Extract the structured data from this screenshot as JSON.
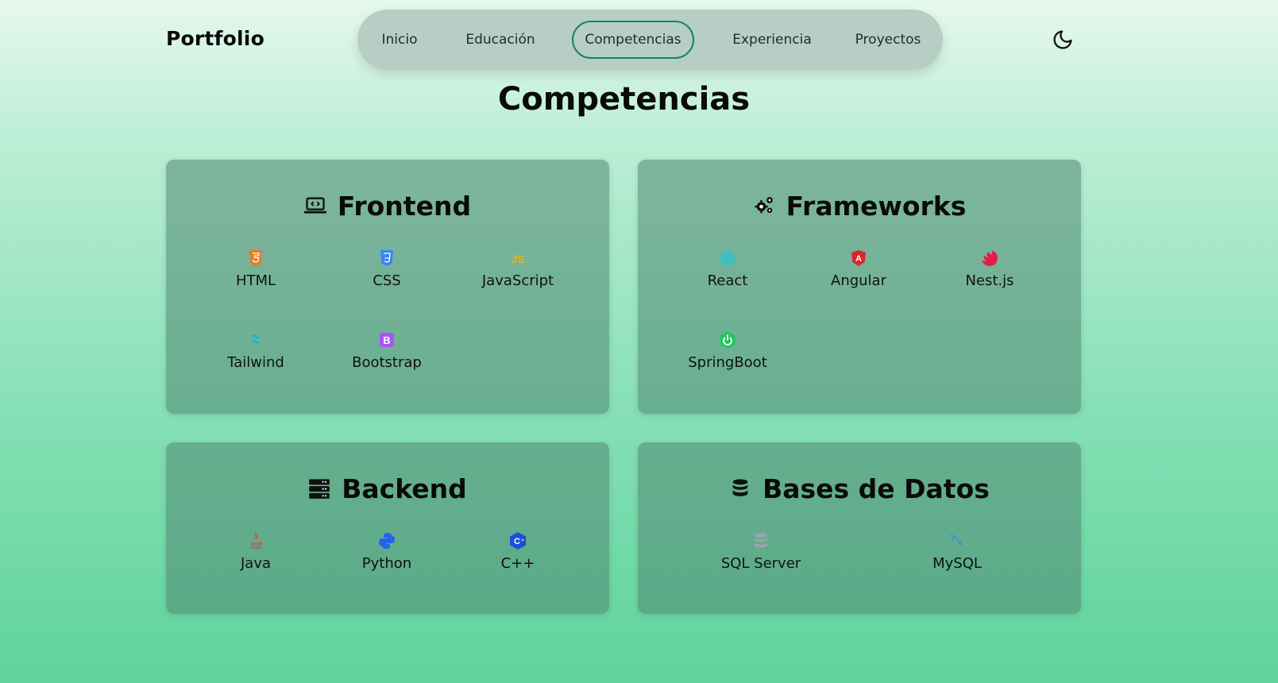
{
  "header": {
    "logo": "Portfolio",
    "nav": [
      {
        "label": "Inicio",
        "active": false
      },
      {
        "label": "Educación",
        "active": false
      },
      {
        "label": "Competencias",
        "active": true
      },
      {
        "label": "Experiencia",
        "active": false
      },
      {
        "label": "Proyectos",
        "active": false
      }
    ],
    "theme_toggle_icon": "moon-icon"
  },
  "page_title": "Competencias",
  "cards": [
    {
      "title": "Frontend",
      "icon": "laptop-code-icon",
      "skills": [
        {
          "label": "HTML",
          "icon": "html5-icon",
          "color": "#e87a2a"
        },
        {
          "label": "CSS",
          "icon": "css3-icon",
          "color": "#3b82f6"
        },
        {
          "label": "JavaScript",
          "icon": "javascript-icon",
          "color": "#eab308"
        },
        {
          "label": "Tailwind",
          "icon": "tailwind-icon",
          "color": "#06b6d4"
        },
        {
          "label": "Bootstrap",
          "icon": "bootstrap-icon",
          "color": "#a855f7"
        }
      ]
    },
    {
      "title": "Frameworks",
      "icon": "gears-icon",
      "skills": [
        {
          "label": "React",
          "icon": "react-icon",
          "color": "#22c5d8"
        },
        {
          "label": "Angular",
          "icon": "angular-icon",
          "color": "#dc2626"
        },
        {
          "label": "Nest.js",
          "icon": "nestjs-icon",
          "color": "#e11d48"
        },
        {
          "label": "SpringBoot",
          "icon": "springboot-icon",
          "color": "#22c55e"
        }
      ]
    },
    {
      "title": "Backend",
      "icon": "server-icon",
      "skills": [
        {
          "label": "Java",
          "icon": "java-icon",
          "color": "#d94b3d"
        },
        {
          "label": "Python",
          "icon": "python-icon",
          "color": "#2563eb"
        },
        {
          "label": "C++",
          "icon": "cplusplus-icon",
          "color": "#1d4ed8"
        }
      ]
    },
    {
      "title": "Bases de Datos",
      "icon": "database-icon",
      "skills": [
        {
          "label": "SQL Server",
          "icon": "sql-server-icon",
          "color": "#9ca3af"
        },
        {
          "label": "MySQL",
          "icon": "mysql-icon",
          "color": "#3b82f6"
        }
      ]
    }
  ]
}
